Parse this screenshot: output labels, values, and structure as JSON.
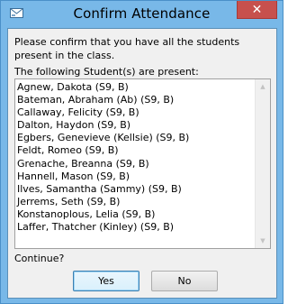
{
  "window": {
    "title": "Confirm Attendance",
    "close_glyph": "✕",
    "app_icon": "envelope-icon"
  },
  "dialog": {
    "message": "Please confirm that you have all the students present in the class.",
    "present_label": "The following Student(s) are present:",
    "students": [
      "Agnew, Dakota (S9, B)",
      "Bateman, Abraham (Ab) (S9, B)",
      "Callaway, Felicity (S9, B)",
      "Dalton, Haydon (S9, B)",
      "Egbers, Genevieve (Kellsie) (S9, B)",
      "Feldt, Romeo (S9, B)",
      "Grenache, Breanna (S9, B)",
      "Hannell, Mason (S9, B)",
      "Ilves, Samantha (Sammy) (S9, B)",
      "Jerrems, Seth (S9, B)",
      "Konstanoplous, Lelia (S9, B)",
      "Laffer, Thatcher (Kinley) (S9, B)"
    ],
    "continue_label": "Continue?",
    "yes_label": "Yes",
    "no_label": "No"
  },
  "colors": {
    "frame": "#78b8e8",
    "close_button": "#c7504d",
    "client_bg": "#f0f0f0"
  }
}
